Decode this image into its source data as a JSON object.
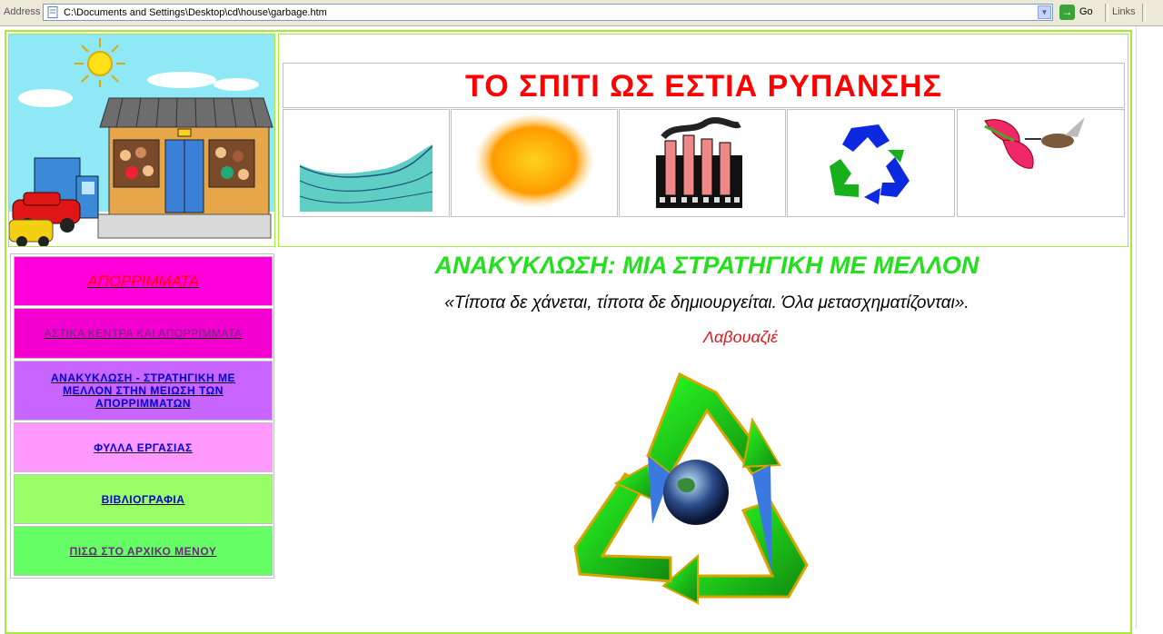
{
  "browser": {
    "address_label": "Address",
    "url": "C:\\Documents and Settings\\Desktop\\cd\\house\\garbage.htm",
    "go_label": "Go",
    "links_label": "Links"
  },
  "banner": {
    "title": "ΤΟ ΣΠΙΤΙ ΩΣ ΕΣΤΙΑ ΡΥΠΑΝΣΗΣ",
    "thumbnails": [
      "sea-wave-image",
      "sun-image",
      "factory-image",
      "recycle-logo-image",
      "flowers-hummingbird-image"
    ]
  },
  "nav": {
    "items": [
      {
        "label": "ΑΠΟΡΡΙΜΜΑΤΑ",
        "bg": "#ff00dc",
        "color": "#ff0000"
      },
      {
        "label": "ΑΣΤΙΚΑ ΚΕΝΤΡΑ ΚΑΙ ΑΠΟΡΡΙΜΜΑΤΑ",
        "bg": "#f300d0",
        "color": "#6a2a7a"
      },
      {
        "label": "ΑΝΑΚΥΚΛΩΣΗ - ΣΤΡΑΤΗΓΙΚΗ ΜΕ ΜΕΛΛΟΝ ΣΤΗΝ ΜΕΙΩΣΗ ΤΩΝ ΑΠΟΡΡΙΜΜΑΤΩΝ",
        "bg": "#c864ff",
        "color": "#0000cc"
      },
      {
        "label": "ΦΥΛΛΑ ΕΡΓΑΣΙΑΣ",
        "bg": "#ff99ff",
        "color": "#0000cc"
      },
      {
        "label": "ΒΙΒΛΙΟΓΡΑΦΙΑ",
        "bg": "#99ff66",
        "color": "#0000cc"
      },
      {
        "label": "ΠΙΣΩ ΣΤΟ ΑΡΧΙΚΟ ΜΕΝΟΥ",
        "bg": "#66ff66",
        "color": "#6a2a7a"
      }
    ]
  },
  "main": {
    "heading": "ΑΝΑΚΥΚΛΩΣΗ: ΜΙΑ ΣΤΡΑΤΗΓΙΚΗ ΜΕ ΜΕΛΛΟΝ",
    "quote": "«Τίποτα δε χάνεται, τίποτα δε δημιουργείται. Όλα μετασχηματίζονται».",
    "author": "Λαβουαζιέ"
  },
  "colors": {
    "frame_border": "#a6ea3c",
    "heading": "#22e01c",
    "title": "#ff0000",
    "author": "#e0161e"
  }
}
